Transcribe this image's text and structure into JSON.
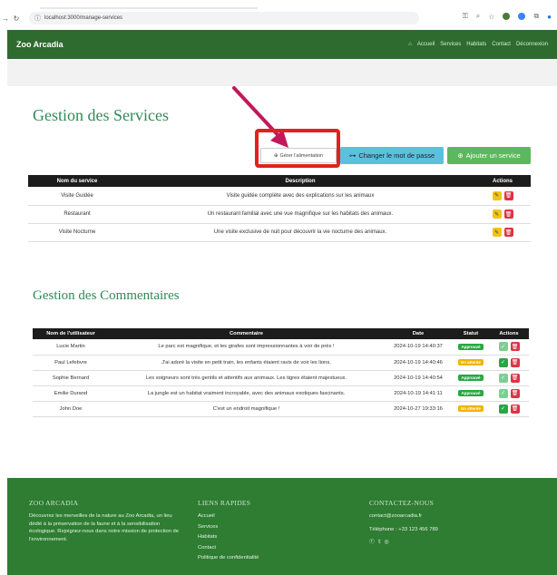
{
  "browser": {
    "url": "localhost:3000/manage-services"
  },
  "navbar": {
    "brand": "Zoo Arcadia",
    "links": [
      "Accueil",
      "Services",
      "Habitats",
      "Contact",
      "Déconnexion"
    ]
  },
  "services_section": {
    "title": "Gestion des Services",
    "buttons": {
      "food": "Gérer l'alimentation",
      "password": "Changer le mot de passe",
      "add": "Ajouter un service"
    },
    "headers": [
      "Nom du service",
      "Description",
      "Actions"
    ],
    "rows": [
      {
        "name": "Visite Guidée",
        "description": "Visite guidée complète avec des explications sur les animaux"
      },
      {
        "name": "Restaurant",
        "description": "Un restaurant familial avec une vue magnifique sur les habitats des animaux."
      },
      {
        "name": "Visite Nocturne",
        "description": "Une visite exclusive de nuit pour découvrir la vie nocturne des animaux."
      }
    ]
  },
  "comments_section": {
    "title": "Gestion des Commentaires",
    "headers": [
      "Nom de l'utilisateur",
      "Commentaire",
      "Date",
      "Statut",
      "Actions"
    ],
    "rows": [
      {
        "user": "Lucie Martin",
        "comment": "Le parc est magnifique, et les girafes sont impressionnantes à voir de près !",
        "date": "2024-10-19 14:40:37",
        "status": "Approuvé",
        "approved": true
      },
      {
        "user": "Paul Lefebvre",
        "comment": "J'ai adoré la visite en petit train, les enfants étaient ravis de voir les lions.",
        "date": "2024-10-19 14:40:46",
        "status": "En attente",
        "approved": false
      },
      {
        "user": "Sophie Bernard",
        "comment": "Les soigneurs sont très gentils et attentifs aux animaux. Les tigres étaient majestueux.",
        "date": "2024-10-19 14:40:54",
        "status": "Approuvé",
        "approved": true
      },
      {
        "user": "Emilie Durand",
        "comment": "La jungle est un habitat vraiment incroyable, avec des animaux exotiques fascinants.",
        "date": "2024-10-19 14:41:11",
        "status": "Approuvé",
        "approved": true
      },
      {
        "user": "John Doe",
        "comment": "C'est un endroit magnifique !",
        "date": "2024-10-27 19:33:16",
        "status": "En attente",
        "approved": false
      }
    ]
  },
  "footer": {
    "about_title": "ZOO ARCADIA",
    "about_text": "Découvrez les merveilles de la nature au Zoo Arcadia, un lieu dédié à la préservation de la faune et à la sensibilisation écologique. Rejoignez-nous dans notre mission de protection de l'environnement.",
    "links_title": "LIENS RAPIDES",
    "links": [
      "Accueil",
      "Services",
      "Habitats",
      "Contact",
      "Politique de confidentialité"
    ],
    "contact_title": "CONTACTEZ-NOUS",
    "email": "contact@zooarcadia.fr",
    "phone": "Téléphone : +33 123 456 789"
  },
  "colors": {
    "brand_green": "#2e6b2e",
    "heading_green": "#2e8b57",
    "annotation_red": "#e0221c"
  }
}
